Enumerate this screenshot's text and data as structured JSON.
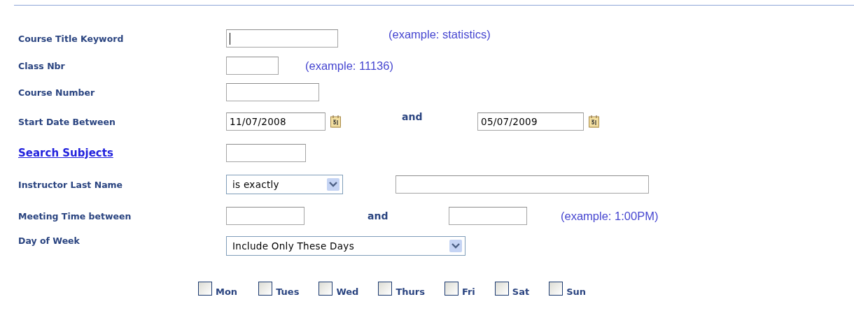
{
  "rows": [
    {
      "label": "Course Title Keyword",
      "link": false,
      "controls": [
        {
          "kind": "input",
          "focused": true
        },
        {
          "kind": "hint",
          "text": "(example: statistics)"
        }
      ]
    },
    {
      "label": "Class Nbr",
      "link": false,
      "controls": [
        {
          "kind": "input",
          "focused": false
        },
        {
          "kind": "hint",
          "text": "(example: 11136)"
        }
      ]
    },
    {
      "label": "Course Number",
      "link": false,
      "controls": [
        {
          "kind": "input",
          "focused": false
        }
      ]
    },
    {
      "label": "Start Date Between",
      "link": false,
      "controls": [
        {
          "kind": "date",
          "value": "11/07/2008"
        },
        {
          "kind": "and",
          "text": "and"
        },
        {
          "kind": "date",
          "value": "05/07/2009"
        }
      ]
    },
    {
      "label": "Search Subjects",
      "link": true,
      "controls": [
        {
          "kind": "input",
          "focused": false
        }
      ]
    },
    {
      "label": "Instructor Last Name",
      "link": false,
      "controls": [
        {
          "kind": "select",
          "value": "is exactly"
        },
        {
          "kind": "input",
          "focused": false
        }
      ]
    },
    {
      "label": "Meeting Time between",
      "link": false,
      "controls": [
        {
          "kind": "input",
          "focused": false
        },
        {
          "kind": "and",
          "text": "and"
        },
        {
          "kind": "input",
          "focused": false
        },
        {
          "kind": "hint",
          "text": "(example: 1:00PM)"
        }
      ]
    },
    {
      "label": "Day of Week",
      "link": false,
      "controls": [
        {
          "kind": "select",
          "value": "Include Only These Days"
        }
      ]
    }
  ],
  "days": [
    {
      "label": "Mon",
      "checked": false
    },
    {
      "label": "Tues",
      "checked": false
    },
    {
      "label": "Wed",
      "checked": false
    },
    {
      "label": "Thurs",
      "checked": false
    },
    {
      "label": "Fri",
      "checked": false
    },
    {
      "label": "Sat",
      "checked": false
    },
    {
      "label": "Sun",
      "checked": false
    }
  ]
}
